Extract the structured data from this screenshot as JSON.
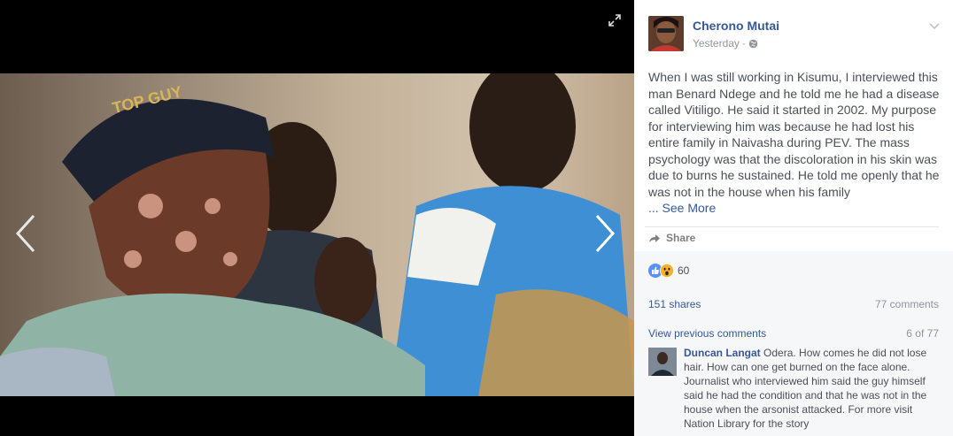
{
  "viewer": {
    "expand_icon": "expand-icon",
    "prev_icon": "chevron-left-icon",
    "next_icon": "chevron-right-icon",
    "photo_cap_text": "TOP GUY"
  },
  "post": {
    "author": "Cherono Mutai",
    "timestamp": "Yesterday",
    "separator": "·",
    "privacy_icon": "globe-icon",
    "options_icon": "chevron-down-icon",
    "text": "When I was still working in Kisumu, I interviewed this man Benard Ndege and he told me he had a disease called Vitiligo. He said it started in 2002. My purpose for interviewing him was because he had lost his entire family in Naivasha during PEV. The mass psychology was that the discoloration in his skin was due to burns he sustained. He told me openly that he was not in the house when his family",
    "see_more": "... See More",
    "share_label": "Share"
  },
  "stats": {
    "reaction_count": "60",
    "reaction_icons": [
      "like-icon",
      "wow-icon"
    ],
    "shares": "151 shares",
    "comments": "77 comments"
  },
  "comments": {
    "view_previous": "View previous comments",
    "pager": "6 of 77",
    "items": [
      {
        "author": "Duncan Langat",
        "text": "Odera. How comes he did not lose hair. How can one get burned on the face alone. Journalist who interviewed him said the guy himself said he had the condition and that he was not in the house when the arsonist attacked. For more visit Nation Library for the story"
      }
    ]
  },
  "colors": {
    "link": "#365899",
    "text": "#4b4f56",
    "muted": "#90949c",
    "like_blue": "#5890ff",
    "wow_yellow": "#f7b125"
  }
}
